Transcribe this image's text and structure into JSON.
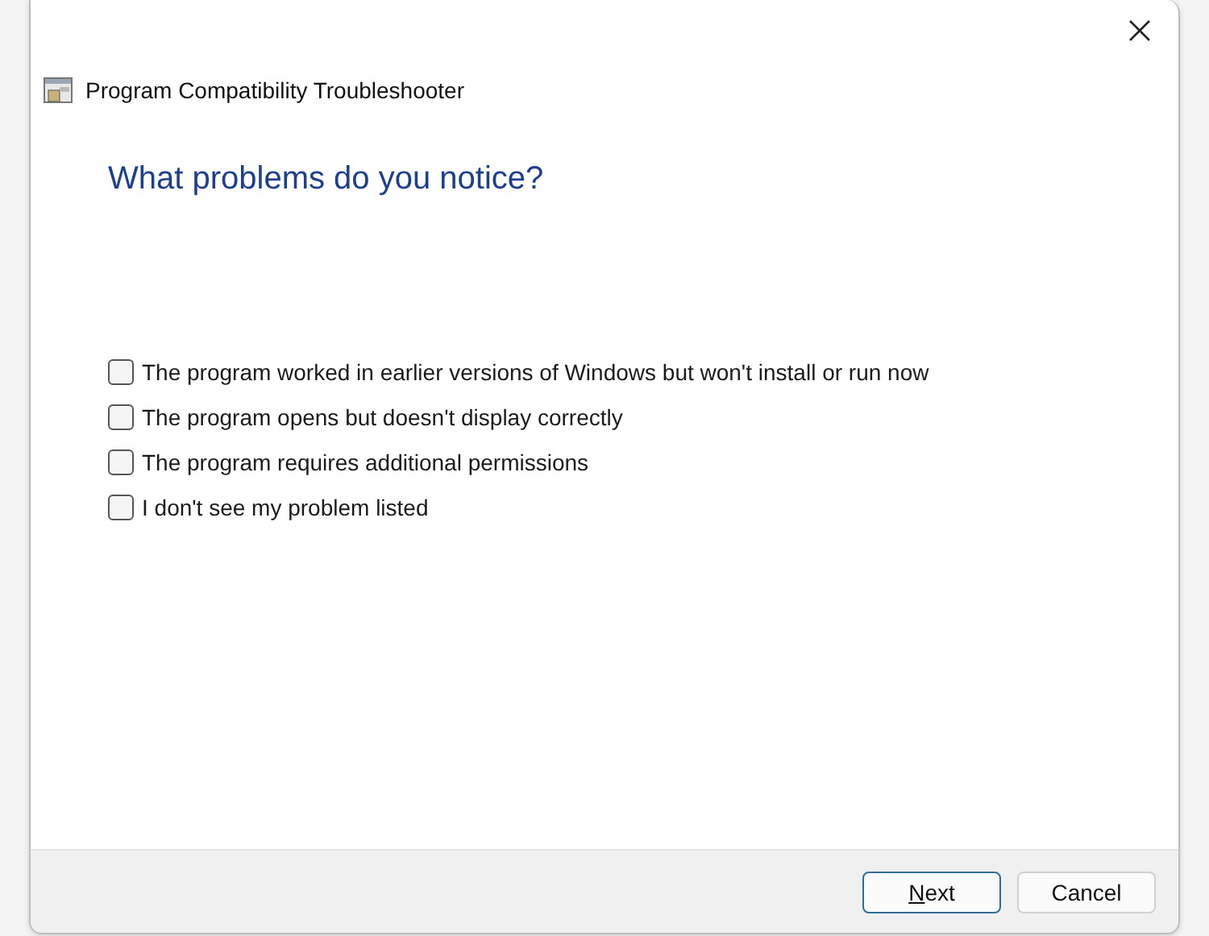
{
  "window": {
    "title": "Program Compatibility Troubleshooter"
  },
  "heading": "What problems do you notice?",
  "options": [
    {
      "label": "The program worked in earlier versions of Windows but won't install or run now",
      "checked": false
    },
    {
      "label": "The program opens but doesn't display correctly",
      "checked": false
    },
    {
      "label": "The program requires additional permissions",
      "checked": false
    },
    {
      "label": "I don't see my problem listed",
      "checked": false
    }
  ],
  "buttons": [
    {
      "label": "Next",
      "default": true,
      "access_key_underlined": true
    },
    {
      "label": "Cancel",
      "default": false
    }
  ]
}
